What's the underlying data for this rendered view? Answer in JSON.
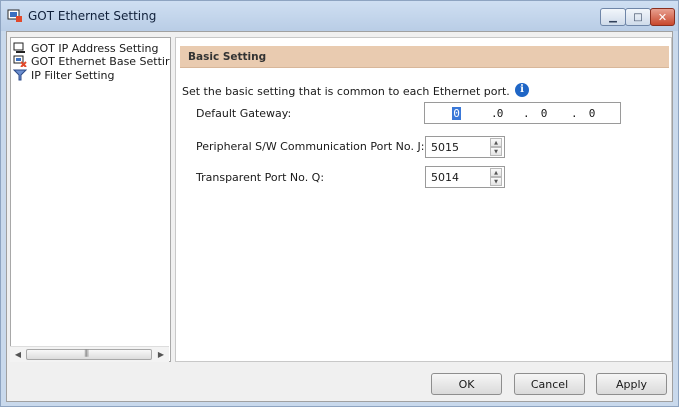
{
  "window": {
    "title": "GOT Ethernet Setting",
    "controls": {
      "minimize": "▁",
      "maximize": "□",
      "close": "✕"
    }
  },
  "tree": {
    "items": [
      {
        "label": "GOT IP Address Setting",
        "icon": "network-settings-icon"
      },
      {
        "label": "GOT Ethernet Base Settir",
        "icon": "ethernet-base-icon"
      },
      {
        "label": "IP Filter Setting",
        "icon": "filter-icon"
      }
    ],
    "scroll_grip": "|||"
  },
  "panel": {
    "section_title": "Basic Setting",
    "description": "Set the basic setting that is common to each Ethernet port.",
    "info_glyph": "i",
    "default_gateway": {
      "label": "Default Gateway:",
      "octets": [
        "0",
        "0",
        "0",
        "0"
      ],
      "separator": "."
    },
    "peripheral_port": {
      "label": "Peripheral S/W Communication Port No. J:",
      "value": "5015"
    },
    "transparent_port": {
      "label": "Transparent Port No. Q:",
      "value": "5014"
    }
  },
  "buttons": {
    "ok": "OK",
    "cancel": "Cancel",
    "apply": "Apply"
  },
  "colors": {
    "section_header": "#e9cbb0",
    "titlebar": "#c9d9ec",
    "selection": "#3a78d8",
    "info": "#1f66c6"
  }
}
